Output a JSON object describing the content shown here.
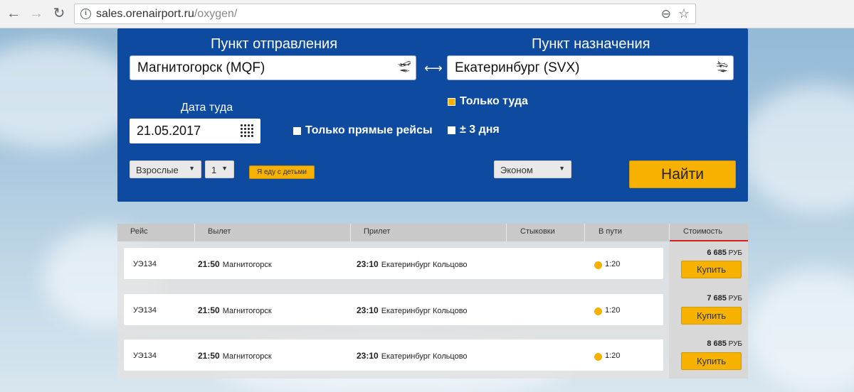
{
  "browser": {
    "url_host": "sales.orenairport.ru",
    "url_path": "/oxygen/",
    "icons": [
      "back-arrow-icon",
      "forward-arrow-icon",
      "reload-icon",
      "info-icon",
      "zoom-icon",
      "star-icon"
    ]
  },
  "search": {
    "from_heading": "Пункт отправления",
    "to_heading": "Пункт назначения",
    "from_value": "Магнитогорск (MQF)",
    "to_value": "Екатеринбург (SVX)",
    "date_heading": "Дата туда",
    "date_value": "21.05.2017",
    "direct_only_label": "Только прямые рейсы",
    "one_way_label": "Только туда",
    "plus_minus_label": "± 3 дня",
    "passenger_type": "Взрослые",
    "passenger_count": "1",
    "kids_button": "Я еду с детьми",
    "class_value": "Эконом",
    "find_button": "Найти",
    "one_way_checked": true,
    "direct_only_checked": false,
    "plus_minus_checked": false
  },
  "results": {
    "headers": {
      "flight": "Рейс",
      "departure": "Вылет",
      "arrival": "Прилет",
      "connections": "Стыковки",
      "duration": "В пути",
      "cost": "Стоимость"
    },
    "rows": [
      {
        "flight": "УЭ134",
        "dep_time": "21:50",
        "dep_city": "Магнитогорск",
        "arr_time": "23:10",
        "arr_city": "Екатеринбург Кольцово",
        "duration": "1:20",
        "price": "6 685",
        "currency": "РУБ",
        "buy": "Купить"
      },
      {
        "flight": "УЭ134",
        "dep_time": "21:50",
        "dep_city": "Магнитогорск",
        "arr_time": "23:10",
        "arr_city": "Екатеринбург Кольцово",
        "duration": "1:20",
        "price": "7 685",
        "currency": "РУБ",
        "buy": "Купить"
      },
      {
        "flight": "УЭ134",
        "dep_time": "21:50",
        "dep_city": "Магнитогорск",
        "arr_time": "23:10",
        "arr_city": "Екатеринбург Кольцово",
        "duration": "1:20",
        "price": "8 685",
        "currency": "РУБ",
        "buy": "Купить"
      }
    ]
  },
  "colors": {
    "panel_blue": "#0d4aa0",
    "accent_yellow": "#f7b100",
    "cost_underline": "#d42020"
  }
}
